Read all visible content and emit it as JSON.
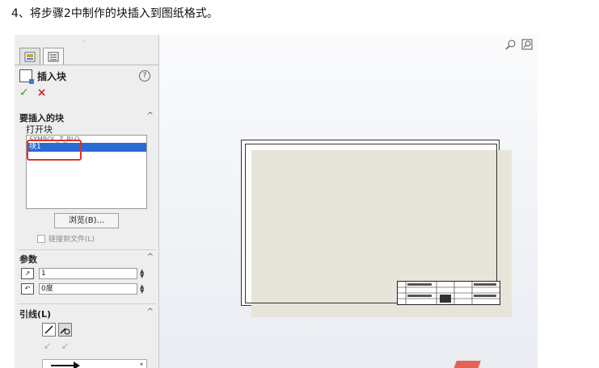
{
  "instruction": "4、将步骤2中制作的块插入到图纸格式。",
  "panel": {
    "title": "插入块",
    "help": "?",
    "ok": "✓",
    "cancel": "×",
    "section_blocks": {
      "header": "要插入的块",
      "open_label": "打开块",
      "items": [
        "SYMBOL_Z_BLO",
        "块1"
      ],
      "selected_index": 1,
      "browse_label": "浏览(B)...",
      "link_label": "链接到文件(L)"
    },
    "section_params": {
      "header": "参数",
      "scale_value": "1",
      "angle_value": "0度"
    },
    "section_leader": {
      "header": "引线(L)"
    }
  },
  "colors": {
    "selection": "#2b6bd3",
    "highlight_box": "#e0302c",
    "ok": "#2f9a2f",
    "cancel": "#d22a2a",
    "sheet_fill": "#e7e5da"
  },
  "viewport": {
    "icons": [
      "zoom-icon",
      "zoom-to-fit-icon"
    ]
  }
}
